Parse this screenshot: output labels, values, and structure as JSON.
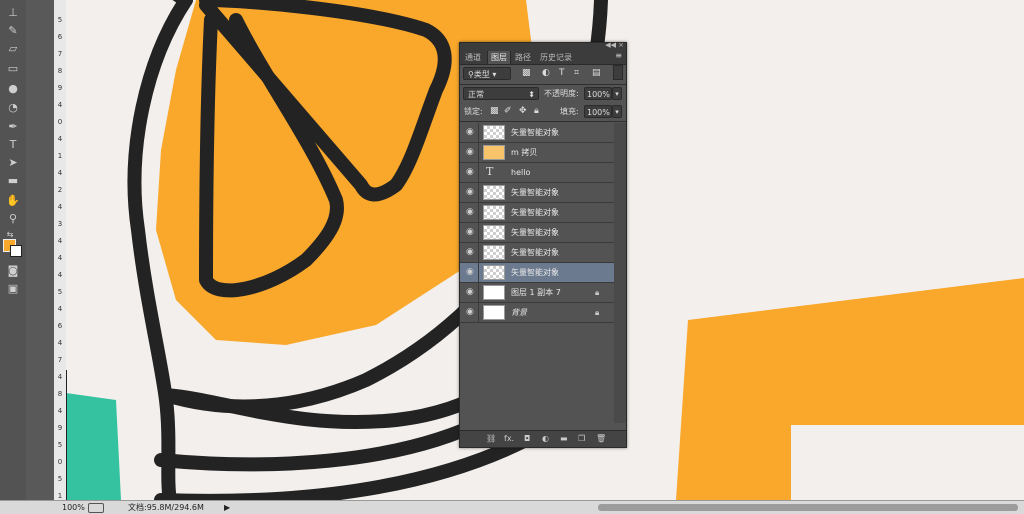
{
  "tools": {
    "icons": [
      "stamp-icon",
      "history-brush-icon",
      "eraser-icon",
      "gradient-icon",
      "blur-icon",
      "dodge-icon",
      "pen-icon",
      "type-tool-icon",
      "path-select-icon",
      "rectangle-shape-icon",
      "hand-icon",
      "zoom-tool-icon",
      "swap-colors-icon",
      "quick-mask-icon",
      "screen-mode-icon"
    ],
    "type_glyph": "T",
    "foreground_color": "#f8a82a",
    "background_color": "#ffffff"
  },
  "ruler": {
    "marks": [
      "5",
      "6",
      "7",
      "8",
      "9",
      "4",
      "0",
      "4",
      "1",
      "4",
      "2",
      "4",
      "3",
      "4",
      "4",
      "4",
      "5",
      "4",
      "6",
      "4",
      "7",
      "4",
      "8",
      "4",
      "9",
      "5",
      "0",
      "5",
      "1"
    ]
  },
  "canvas": {
    "background": "#f3efec",
    "colors": {
      "orange": "#f9a82b",
      "dark": "#232323",
      "teal": "#35c2a0"
    }
  },
  "status": {
    "zoom": "100%",
    "document": "文档:95.8M/294.6M",
    "arrow": "▶"
  },
  "panel": {
    "tabs": [
      "通道",
      "图层",
      "路径",
      "历史记录"
    ],
    "active_tab": "图层",
    "filter_kind": "类型",
    "blend_mode": "正常",
    "opacity_label": "不透明度:",
    "opacity_value": "100%",
    "lock_label": "锁定:",
    "fill_label": "填充:",
    "fill_value": "100%",
    "layers": [
      {
        "name": "矢量智能对象",
        "type": "smart",
        "selected": false
      },
      {
        "name": "m 拷贝",
        "type": "smart",
        "selected": false
      },
      {
        "name": "hello",
        "type": "text",
        "selected": false
      },
      {
        "name": "矢量智能对象",
        "type": "smart",
        "selected": false
      },
      {
        "name": "矢量智能对象",
        "type": "smart",
        "selected": false
      },
      {
        "name": "矢量智能对象",
        "type": "smart",
        "selected": false
      },
      {
        "name": "矢量智能对象",
        "type": "smart",
        "selected": false
      },
      {
        "name": "矢量智能对象",
        "type": "smart",
        "selected": true
      },
      {
        "name": "图层 1 副本 7",
        "type": "pixel",
        "locked": true
      },
      {
        "name": "背景",
        "type": "background",
        "locked": true
      }
    ],
    "bottom_icons": [
      "link-icon",
      "fx-icon",
      "mask-icon",
      "adjustment-icon",
      "group-folder-icon",
      "new-layer-icon",
      "trash-icon"
    ],
    "fx_label": "fx."
  }
}
